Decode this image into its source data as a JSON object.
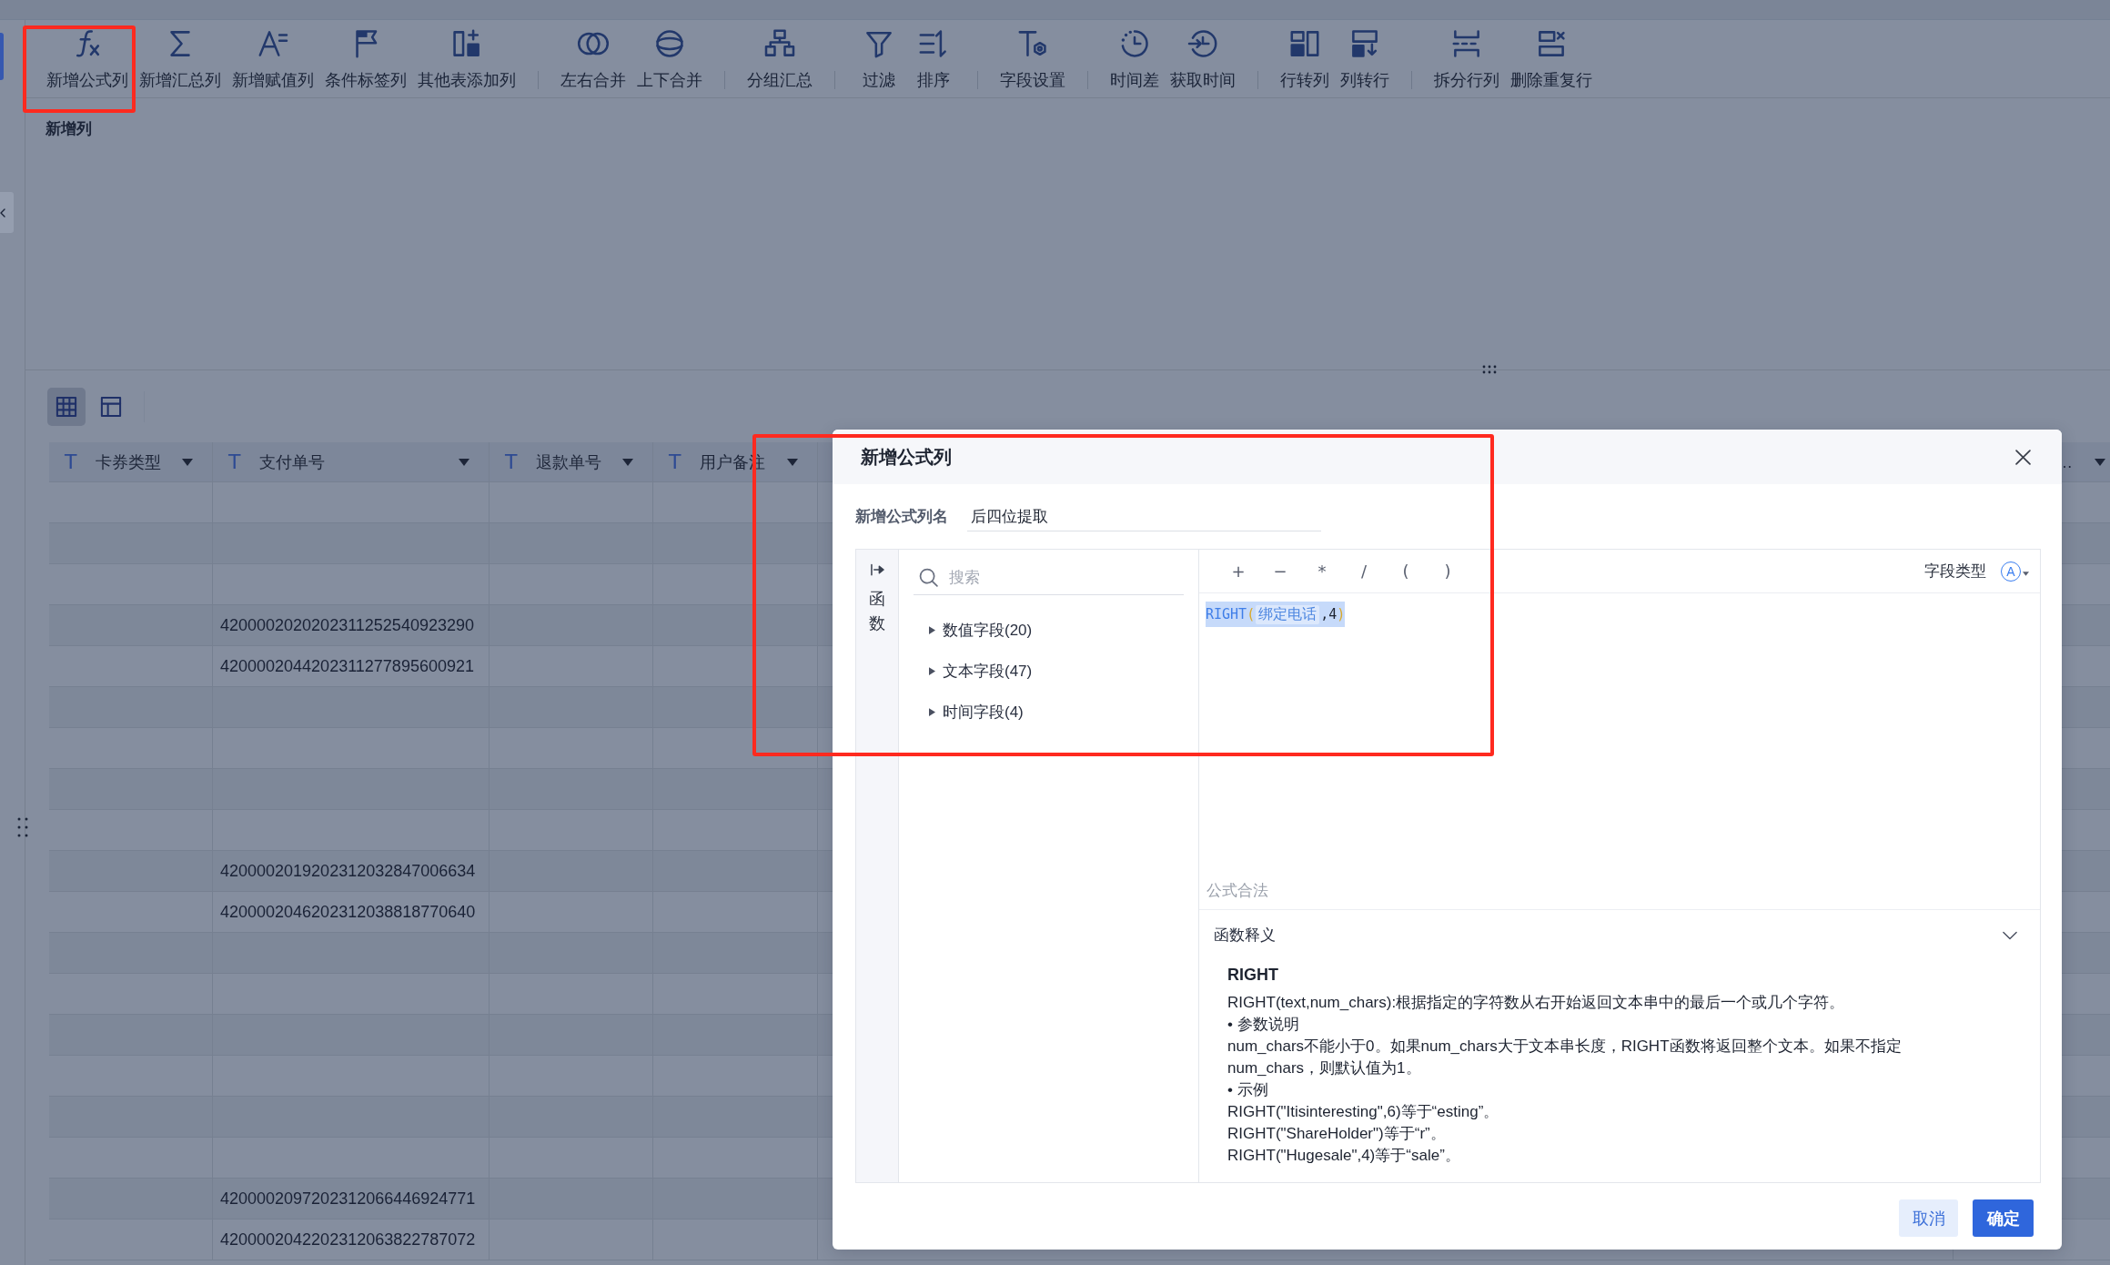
{
  "toolbar": {
    "groups": [
      {
        "items": [
          {
            "label": "新增公式列",
            "highlighted": true
          },
          {
            "label": "新增汇总列",
            "highlighted": false
          },
          {
            "label": "新增赋值列",
            "highlighted": false
          },
          {
            "label": "条件标签列",
            "highlighted": false
          },
          {
            "label": "其他表添加列",
            "highlighted": false
          }
        ]
      },
      {
        "items": [
          {
            "label": "左右合并",
            "highlighted": false
          },
          {
            "label": "上下合并",
            "highlighted": false
          }
        ]
      },
      {
        "items": [
          {
            "label": "分组汇总",
            "highlighted": false
          }
        ]
      },
      {
        "items": [
          {
            "label": "过滤",
            "highlighted": false
          },
          {
            "label": "排序",
            "highlighted": false
          }
        ]
      },
      {
        "items": [
          {
            "label": "字段设置",
            "highlighted": false
          }
        ]
      },
      {
        "items": [
          {
            "label": "时间差",
            "highlighted": false
          },
          {
            "label": "获取时间",
            "highlighted": false
          }
        ]
      },
      {
        "items": [
          {
            "label": "行转列",
            "highlighted": false
          },
          {
            "label": "列转行",
            "highlighted": false
          }
        ]
      },
      {
        "items": [
          {
            "label": "拆分行列",
            "highlighted": false
          },
          {
            "label": "删除重复行",
            "highlighted": false
          }
        ]
      }
    ]
  },
  "section": {
    "title": "新增列"
  },
  "view_toggles": [
    {
      "selected": true
    },
    {
      "selected": false
    }
  ],
  "table": {
    "columns": [
      {
        "type_symbol": "T",
        "label": "卡券类型"
      },
      {
        "type_symbol": "T",
        "label": "支付单号"
      },
      {
        "type_symbol": "T",
        "label": "退款单号"
      },
      {
        "type_symbol": "T",
        "label": "用户备注"
      },
      {
        "label": "…"
      }
    ],
    "rows": [
      {
        "cells": [
          null,
          null,
          null,
          null,
          null
        ]
      },
      {
        "cells": [
          null,
          null,
          null,
          null,
          null
        ]
      },
      {
        "cells": [
          null,
          null,
          null,
          null,
          null
        ]
      },
      {
        "cells": [
          null,
          "4200002020202311252540923290",
          null,
          null,
          null
        ]
      },
      {
        "cells": [
          null,
          "4200002044202311277895600921",
          null,
          null,
          null
        ]
      },
      {
        "cells": [
          null,
          null,
          null,
          null,
          null
        ]
      },
      {
        "cells": [
          null,
          null,
          null,
          null,
          null
        ]
      },
      {
        "cells": [
          null,
          null,
          null,
          null,
          null
        ]
      },
      {
        "cells": [
          null,
          null,
          null,
          null,
          null
        ]
      },
      {
        "cells": [
          null,
          "4200002019202312032847006634",
          null,
          null,
          null
        ]
      },
      {
        "cells": [
          null,
          "4200002046202312038818770640",
          null,
          null,
          null
        ]
      },
      {
        "cells": [
          null,
          null,
          null,
          null,
          null
        ]
      },
      {
        "cells": [
          null,
          null,
          null,
          null,
          null
        ]
      },
      {
        "cells": [
          null,
          null,
          null,
          null,
          null
        ]
      },
      {
        "cells": [
          null,
          null,
          null,
          null,
          null
        ]
      },
      {
        "cells": [
          null,
          null,
          null,
          null,
          null
        ]
      },
      {
        "cells": [
          null,
          null,
          null,
          null,
          null
        ]
      },
      {
        "cells": [
          null,
          "4200002097202312066446924771",
          null,
          null,
          null
        ]
      },
      {
        "cells": [
          null,
          "4200002042202312063822787072",
          null,
          null,
          null
        ]
      }
    ]
  },
  "dialog": {
    "title": "新增公式列",
    "highlighted": true,
    "name_field": {
      "label": "新增公式列名",
      "value": "后四位提取"
    },
    "side_tab": {
      "label": "函数"
    },
    "search": {
      "placeholder": "搜索"
    },
    "field_groups": [
      {
        "label": "数值字段(20)",
        "expanded": false
      },
      {
        "label": "文本字段(47)",
        "expanded": false
      },
      {
        "label": "时间字段(4)",
        "expanded": false
      }
    ],
    "operators": [
      "+",
      "−",
      "*",
      "/",
      "(",
      ")"
    ],
    "field_type": {
      "label": "字段类型",
      "symbol": "A"
    },
    "formula": {
      "selected": true,
      "tokens": [
        {
          "kind": "function",
          "text": "RIGHT"
        },
        {
          "kind": "bracket",
          "text": "("
        },
        {
          "kind": "field",
          "text": "绑定电话"
        },
        {
          "kind": "plain",
          "text": ",4"
        },
        {
          "kind": "bracket",
          "text": ")"
        }
      ]
    },
    "status": "公式合法",
    "explanation": {
      "heading": "函数释义",
      "expanded": true,
      "title": "RIGHT",
      "lines": [
        "RIGHT(text,num_chars):根据指定的字符数从右开始返回文本串中的最后一个或几个字符。",
        "• 参数说明",
        "num_chars不能小于0。如果num_chars大于文本串长度，RIGHT函数将返回整个文本。如果不指定num_chars，则默认值为1。",
        "• 示例",
        "RIGHT(\"Itisinteresting\",6)等于“esting”。",
        "RIGHT(\"ShareHolder\")等于“r”。",
        "RIGHT(\"Hugesale\",4)等于“sale”。"
      ]
    },
    "buttons": [
      {
        "label": "取消",
        "kind": "secondary"
      },
      {
        "label": "确定",
        "kind": "primary"
      }
    ]
  }
}
